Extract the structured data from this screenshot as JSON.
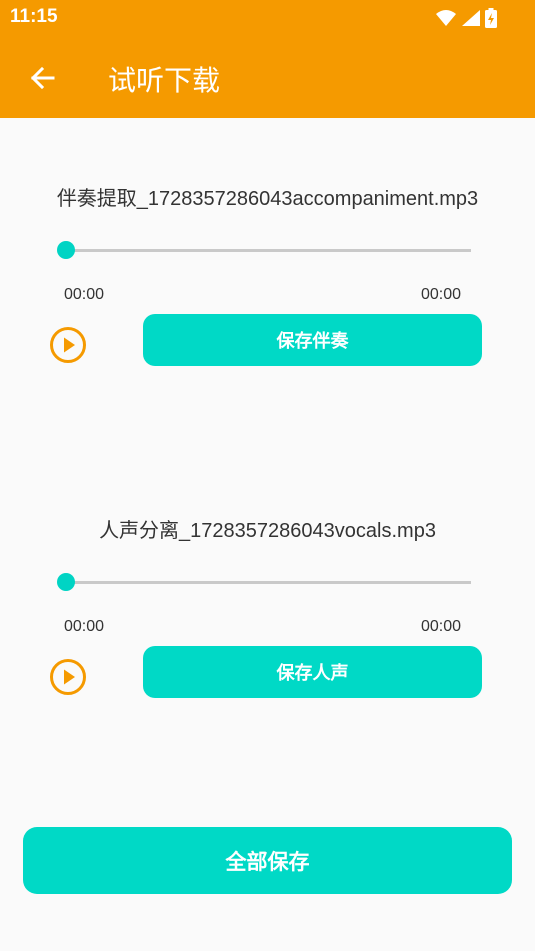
{
  "status_bar": {
    "time": "11:15",
    "icons": [
      "wifi-icon",
      "signal-icon",
      "battery-charging-icon"
    ]
  },
  "header": {
    "back_icon": "arrow-left-icon",
    "title": "试听下载"
  },
  "tracks": [
    {
      "file_name": "伴奏提取_1728357286043accompaniment.mp3",
      "progress": 0,
      "current_time": "00:00",
      "total_time": "00:00",
      "play_icon": "play-circle-icon",
      "save_label": "保存伴奏"
    },
    {
      "file_name": "人声分离_1728357286043vocals.mp3",
      "progress": 0,
      "current_time": "00:00",
      "total_time": "00:00",
      "play_icon": "play-circle-icon",
      "save_label": "保存人声"
    }
  ],
  "footer": {
    "save_all_label": "全部保存"
  },
  "colors": {
    "app_bar": "#f59a00",
    "accent": "#00d9c6",
    "play_icon": "#f59a00",
    "background": "#fafafa"
  }
}
